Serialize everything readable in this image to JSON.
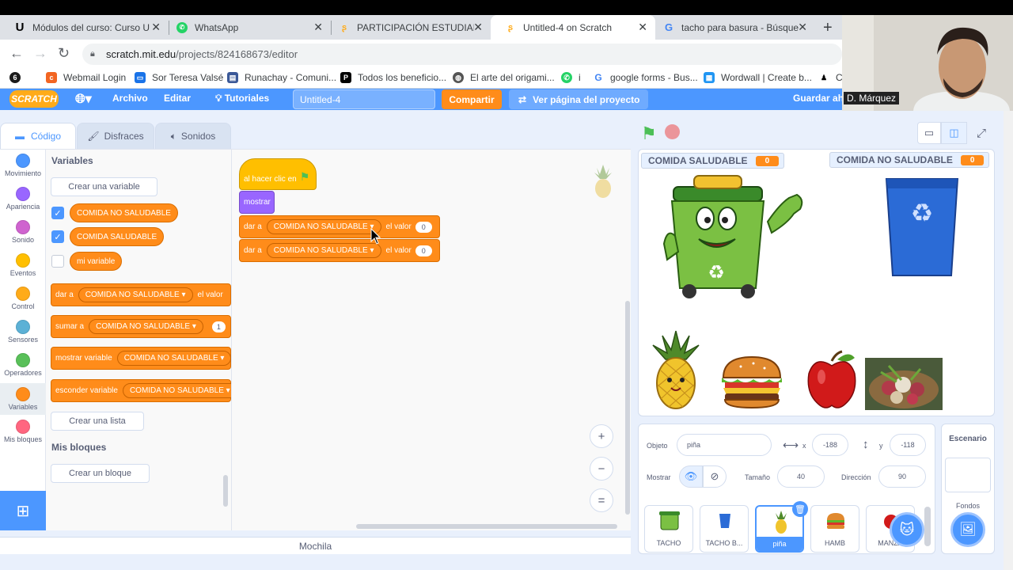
{
  "browser": {
    "tabs": [
      {
        "label": "Módulos del curso: Curso Ur",
        "icon": "U"
      },
      {
        "label": "WhatsApp",
        "icon": "whatsapp-icon"
      },
      {
        "label": "PARTICIPACIÓN ESTUDIANTIL",
        "icon": "scratch-icon"
      },
      {
        "label": "Untitled-4 on Scratch",
        "icon": "scratch-icon"
      },
      {
        "label": "tacho para basura - Búsqueda",
        "icon": "google-icon"
      }
    ],
    "url_host": "scratch.mit.edu",
    "url_path": "/projects/824168673/editor",
    "bookmarks": [
      "Webmail Login",
      "Sor Teresa Valsé",
      "Runachay - Comuni...",
      "Todos los beneficio...",
      "El arte del origami...",
      "i",
      "google forms - Bus...",
      "Wordwall | Create b...",
      "Ca"
    ]
  },
  "menu": {
    "logo": "SCRATCH",
    "file": "Archivo",
    "edit": "Editar",
    "tutorials": "Tutoriales",
    "title": "Untitled-4",
    "share": "Compartir",
    "see_project": "Ver página del proyecto",
    "save": "Guardar aho"
  },
  "tabs": {
    "code": "Código",
    "costumes": "Disfraces",
    "sounds": "Sonidos"
  },
  "categories": [
    {
      "label": "Movimiento",
      "color": "#4c97ff"
    },
    {
      "label": "Apariencia",
      "color": "#9966ff"
    },
    {
      "label": "Sonido",
      "color": "#cf63cf"
    },
    {
      "label": "Eventos",
      "color": "#ffbf00"
    },
    {
      "label": "Control",
      "color": "#ffab19"
    },
    {
      "label": "Sensores",
      "color": "#5cb1d6"
    },
    {
      "label": "Operadores",
      "color": "#59c059"
    },
    {
      "label": "Variables",
      "color": "#ff8c1a"
    },
    {
      "label": "Mis bloques",
      "color": "#ff6680"
    }
  ],
  "palette": {
    "variables_heading": "Variables",
    "make_variable": "Crear una variable",
    "var1": "COMIDA NO SALUDABLE",
    "var2": "COMIDA SALUDABLE",
    "var3": "mi variable",
    "set_to": "dar a",
    "set_value": "el valor",
    "change_by": "sumar a",
    "change_num": "1",
    "show_var": "mostrar variable",
    "hide_var": "esconder variable",
    "make_list": "Crear una lista",
    "my_blocks_heading": "Mis bloques",
    "make_block": "Crear un bloque"
  },
  "script": {
    "hat": "al hacer clic en",
    "show": "mostrar",
    "set1_prefix": "dar a",
    "set1_var": "COMIDA NO SALUDABLE",
    "set1_mid": "el valor",
    "set1_num": "0",
    "set2_prefix": "dar a",
    "set2_var": "COMIDA NO SALUDABLE",
    "set2_mid": "el valor",
    "set2_num": "0"
  },
  "backpack": "Mochila",
  "stage": {
    "monitor1_label": "COMIDA SALUDABLE",
    "monitor1_value": "0",
    "monitor2_label": "COMIDA NO SALUDABLE",
    "monitor2_value": "0"
  },
  "sprite_info": {
    "sprite_label": "Objeto",
    "sprite_name": "piña",
    "x_label": "x",
    "x_value": "-188",
    "y_label": "y",
    "y_value": "-118",
    "show_label": "Mostrar",
    "size_label": "Tamaño",
    "size_value": "40",
    "direction_label": "Dirección",
    "direction_value": "90"
  },
  "stage_panel": {
    "title": "Escenario",
    "backdrops": "Fondos"
  },
  "sprites": [
    "TACHO",
    "TACHO B...",
    "piña",
    "HAMB",
    "MANZA"
  ],
  "webcam_name": "D. Márquez"
}
